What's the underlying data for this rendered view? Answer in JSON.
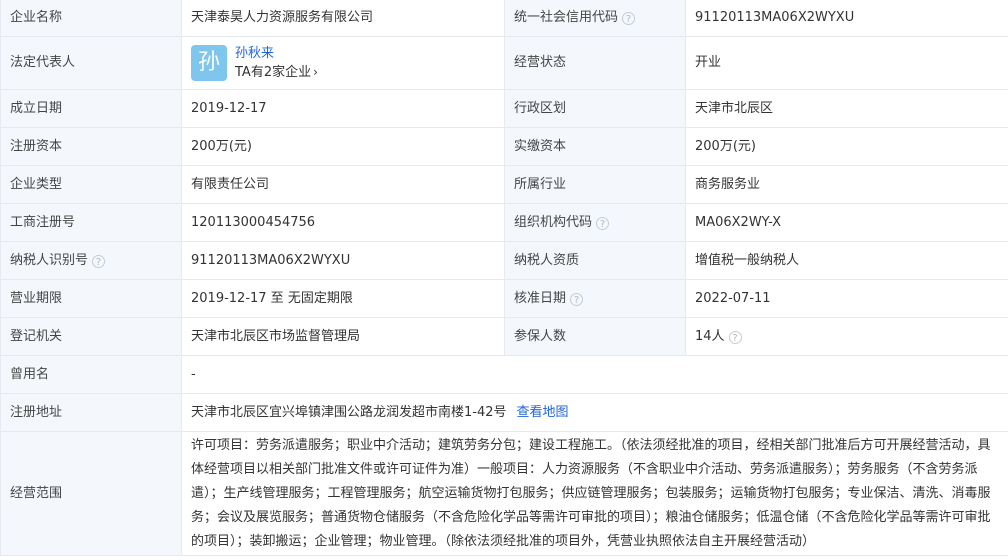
{
  "labels": {
    "company_name": "企业名称",
    "credit_code": "统一社会信用代码",
    "legal_rep": "法定代表人",
    "status": "经营状态",
    "founded": "成立日期",
    "region": "行政区划",
    "reg_capital": "注册资本",
    "paid_capital": "实缴资本",
    "company_type": "企业类型",
    "industry": "所属行业",
    "reg_number": "工商注册号",
    "org_code": "组织机构代码",
    "taxpayer_id": "纳税人识别号",
    "taxpayer_qual": "纳税人资质",
    "term": "营业期限",
    "approval_date": "核准日期",
    "registrar": "登记机关",
    "insured": "参保人数",
    "former_name": "曾用名",
    "address": "注册地址",
    "scope": "经营范围"
  },
  "values": {
    "company_name": "天津泰昊人力资源服务有限公司",
    "credit_code": "91120113MA06X2WYXU",
    "legal_rep_avatar": "孙",
    "legal_rep_name": "孙秋来",
    "legal_rep_companies": "TA有2家企业",
    "status": "开业",
    "founded": "2019-12-17",
    "region": "天津市北辰区",
    "reg_capital": "200万(元)",
    "paid_capital": "200万(元)",
    "company_type": "有限责任公司",
    "industry": "商务服务业",
    "reg_number": "120113000454756",
    "org_code": "MA06X2WY-X",
    "taxpayer_id": "91120113MA06X2WYXU",
    "taxpayer_qual": "增值税一般纳税人",
    "term": "2019-12-17 至 无固定期限",
    "approval_date": "2022-07-11",
    "registrar": "天津市北辰区市场监督管理局",
    "insured": "14人",
    "former_name": "-",
    "address": "天津市北辰区宜兴埠镇津围公路龙润发超市南楼1-42号",
    "address_link": "查看地图",
    "scope": "许可项目：劳务派遣服务；职业中介活动；建筑劳务分包；建设工程施工。（依法须经批准的项目，经相关部门批准后方可开展经营活动，具体经营项目以相关部门批准文件或许可证件为准）一般项目：人力资源服务（不含职业中介活动、劳务派遣服务）；劳务服务（不含劳务派遣）；生产线管理服务；工程管理服务；航空运输货物打包服务；供应链管理服务；包装服务；运输货物打包服务；专业保洁、清洗、消毒服务；会议及展览服务；普通货物仓储服务（不含危险化学品等需许可审批的项目）；粮油仓储服务；低温仓储（不含危险化学品等需许可审批的项目）；装卸搬运；企业管理；物业管理。（除依法须经批准的项目外，凭营业执照依法自主开展经营活动）"
  },
  "help_glyph": "?",
  "chevron_glyph": "›",
  "colors": {
    "label_bg": "#f4f8fd",
    "border": "#e6e9ef",
    "link": "#1f66d9",
    "avatar_bg": "#7fc6ee"
  }
}
